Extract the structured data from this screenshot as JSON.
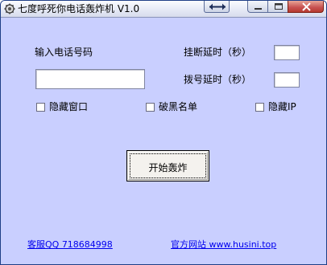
{
  "window": {
    "title": "七度呼死你电话轰炸机 V1.0",
    "background_color": "#c9cfff",
    "icons": [
      "app-gear-icon",
      "swap-arrows-icon",
      "minimize-icon",
      "maximize-icon",
      "close-icon"
    ]
  },
  "form": {
    "phone_label": "输入电话号码",
    "phone_value": "",
    "hangup_delay_label": "挂断延时（秒）",
    "hangup_delay_value": "",
    "dial_delay_label": "拨号延时（秒）",
    "dial_delay_value": "",
    "options": [
      {
        "label": "隐藏窗口",
        "checked": false
      },
      {
        "label": "破黑名单",
        "checked": false
      },
      {
        "label": "隐藏IP",
        "checked": false
      }
    ],
    "start_button": "开始轰炸"
  },
  "footer": {
    "qq_link": "客服QQ  718684998",
    "site_link": "官方网站  www.husini.top"
  }
}
